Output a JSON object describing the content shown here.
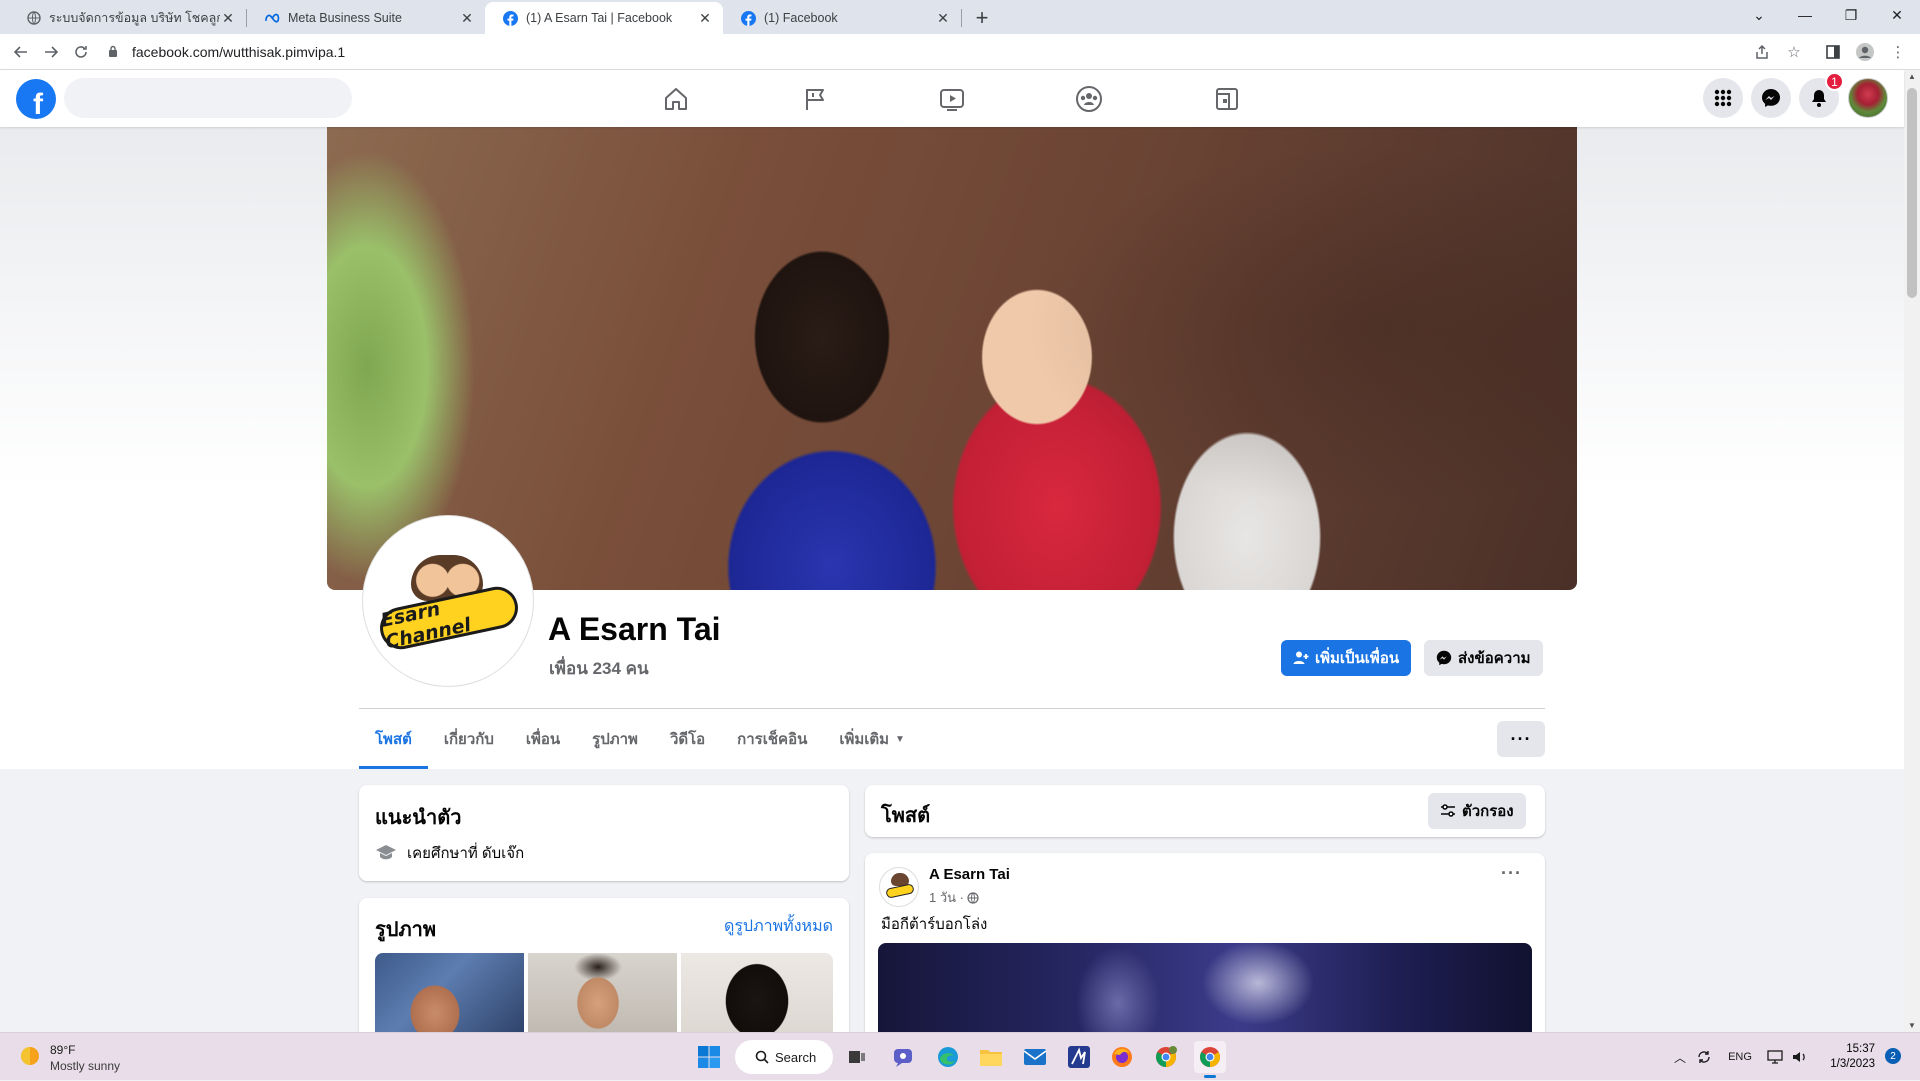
{
  "browser": {
    "tabs": [
      {
        "title": "ระบบจัดการข้อมูล บริษัท โชคลูกโชค ·",
        "icon": "globe-icon",
        "active": false
      },
      {
        "title": "Meta Business Suite",
        "icon": "meta-icon",
        "active": false
      },
      {
        "title": "(1) A Esarn Tai | Facebook",
        "icon": "facebook-icon",
        "active": true
      },
      {
        "title": "(1) Facebook",
        "icon": "facebook-icon",
        "active": false
      }
    ],
    "url": "facebook.com/wutthisak.pimvipa.1"
  },
  "fb_nav": {
    "logo": "f",
    "notification_count": "1",
    "center_icons": [
      "home-icon",
      "pages-flag-icon",
      "watch-video-icon",
      "groups-icon",
      "gaming-icon"
    ]
  },
  "profile": {
    "name": "A Esarn Tai",
    "friends": "เพื่อน 234 คน",
    "logo_text": "Esarn Channel",
    "add_friend_label": "เพิ่มเป็นเพื่อน",
    "message_label": "ส่งข้อความ",
    "tabs": [
      {
        "label": "โพสต์",
        "active": true
      },
      {
        "label": "เกี่ยวกับ",
        "active": false
      },
      {
        "label": "เพื่อน",
        "active": false
      },
      {
        "label": "รูปภาพ",
        "active": false
      },
      {
        "label": "วิดีโอ",
        "active": false
      },
      {
        "label": "การเช็คอิน",
        "active": false
      },
      {
        "label": "เพิ่มเติม",
        "active": false
      }
    ]
  },
  "intro": {
    "heading": "แนะนำตัว",
    "education": "เคยศึกษาที่ ดับเจ๊ก"
  },
  "photos": {
    "heading": "รูปภาพ",
    "see_all": "ดูรูปภาพทั้งหมด"
  },
  "posts": {
    "heading": "โพสต์",
    "filter_label": "ตัวกรอง",
    "items": [
      {
        "author": "A Esarn Tai",
        "time": "1 วัน ·",
        "text": "มือกีต้าร์บอกโล่ง"
      }
    ]
  },
  "taskbar": {
    "weather_temp": "89°F",
    "weather_desc": "Mostly sunny",
    "search_label": "Search",
    "lang": "ENG",
    "time": "15:37",
    "date": "1/3/2023",
    "notifications": "2"
  },
  "colors": {
    "fb_blue": "#1b74e4",
    "badge_red": "#e41e3f"
  }
}
